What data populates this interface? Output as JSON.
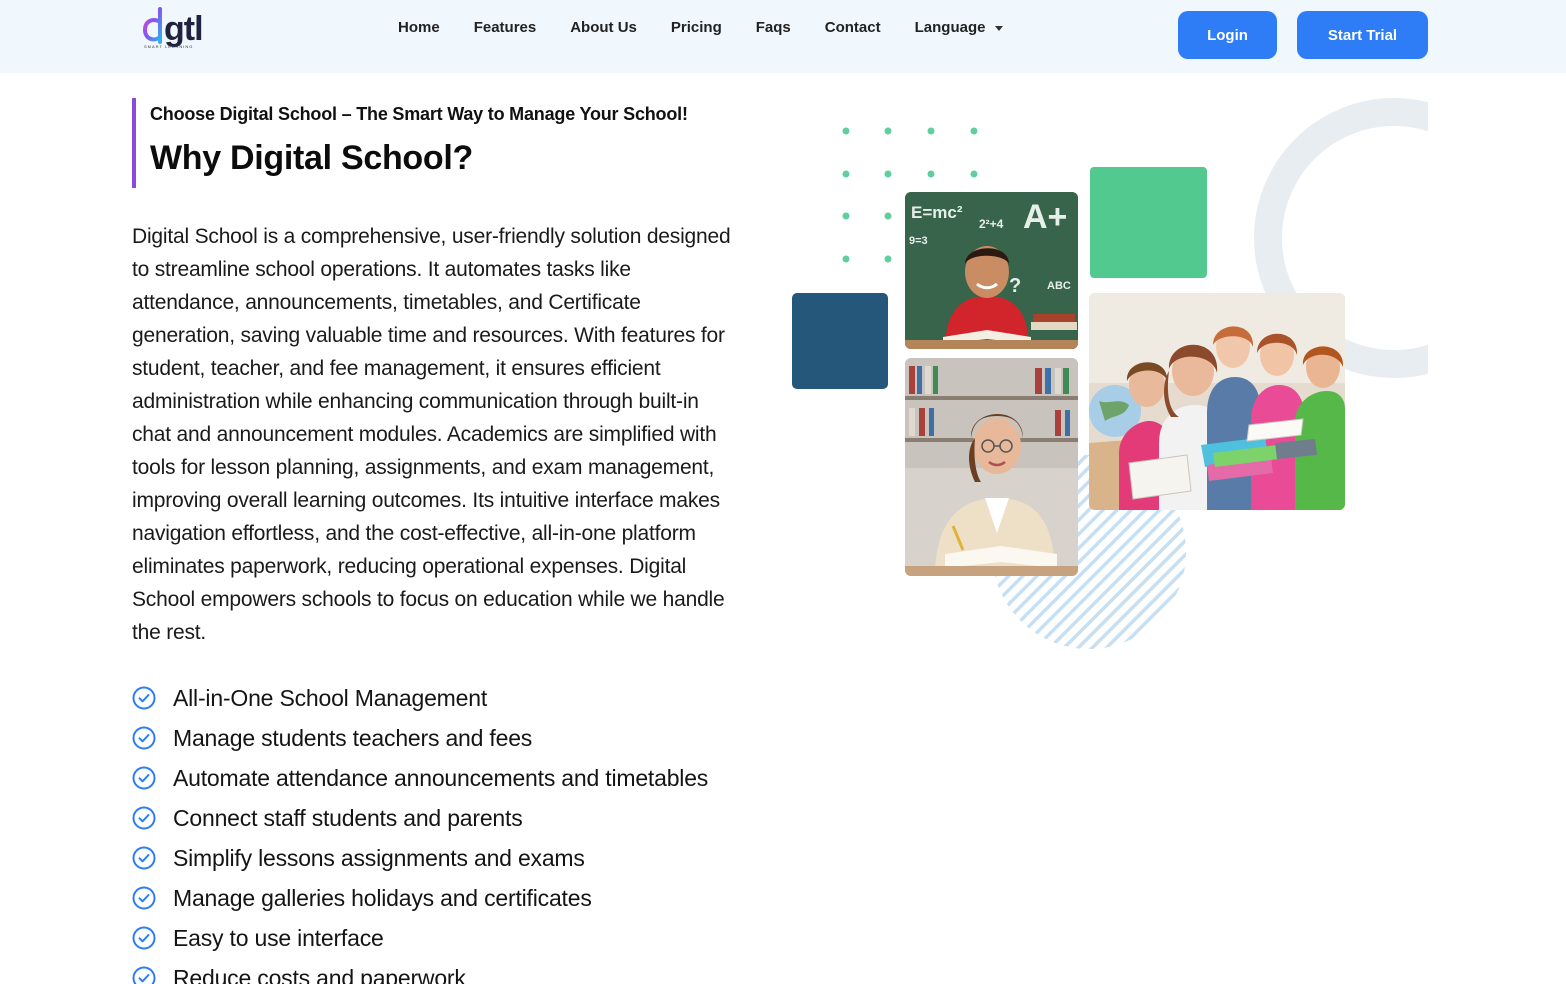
{
  "brand": {
    "logo_text": "gtl",
    "logo_subtext": "SMART LEARNING",
    "colors": {
      "primary_button": "#2e7cf6",
      "accent_bar": "#8a4bdc",
      "navbar_bg": "#f1f8fd",
      "green_tile": "#52c98e",
      "navy_tile": "#245779",
      "check": "#2e7cf6"
    }
  },
  "nav": {
    "links": [
      "Home",
      "Features",
      "About Us",
      "Pricing",
      "Faqs",
      "Contact"
    ],
    "language_label": "Language",
    "login_label": "Login",
    "trial_label": "Start Trial"
  },
  "hero": {
    "eyebrow": "Choose Digital School – The Smart Way to Manage Your School!",
    "title": "Why Digital School?",
    "description": "Digital School is a comprehensive, user-friendly solution designed to streamline school operations. It automates tasks like attendance, announcements, timetables, and Certificate generation, saving valuable time and resources. With features for student, teacher, and fee management, it ensures efficient administration while enhancing communication through built-in chat and announcement modules. Academics are simplified with tools for lesson planning, assignments, and exam management, improving overall learning outcomes. Its intuitive interface makes navigation effortless, and the cost-effective, all-in-one platform eliminates paperwork, reducing operational expenses. Digital School empowers schools to focus on education while we handle the rest."
  },
  "features": [
    "All-in-One School Management",
    "Manage students teachers and fees",
    "Automate attendance announcements and timetables",
    "Connect staff students and parents",
    "Simplify lessons assignments and exams",
    "Manage galleries holidays and certificates",
    "Easy to use interface",
    "Reduce costs and paperwork"
  ],
  "illustration": {
    "chalkboard_text": [
      "E=mc²",
      "A+",
      "9=3",
      "ABC",
      "2²+4",
      "?"
    ]
  }
}
